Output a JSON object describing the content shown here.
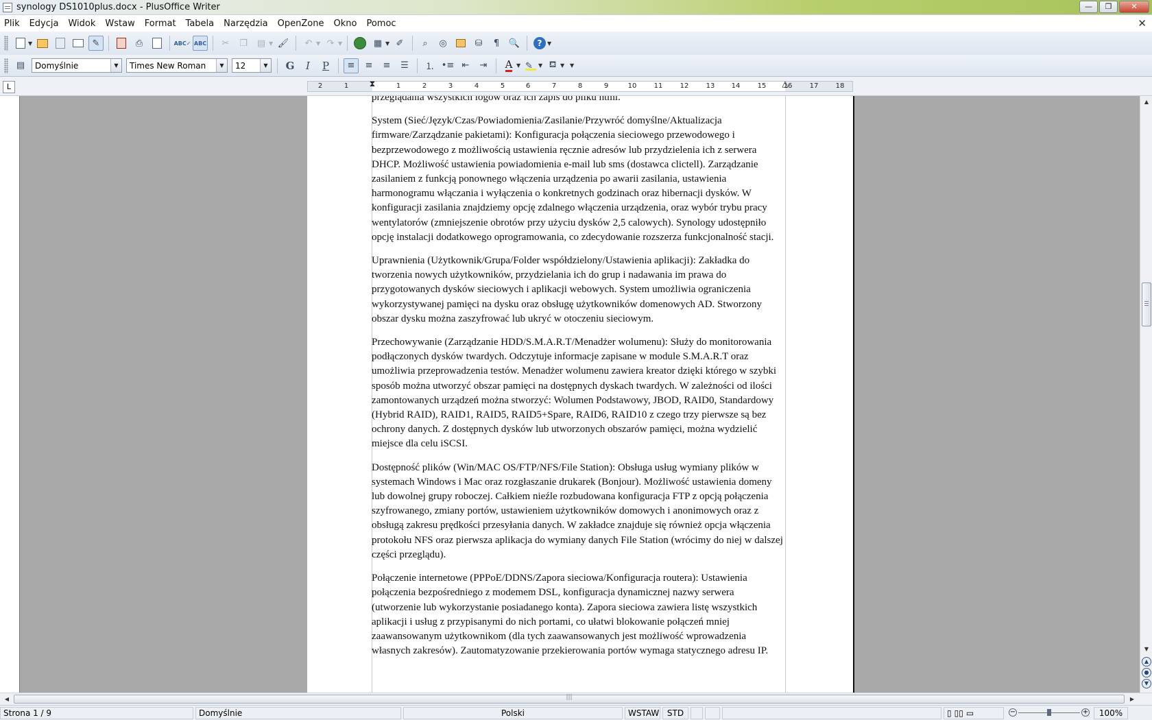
{
  "window": {
    "title": "synology DS1010plus.docx - PlusOffice Writer",
    "minimize": "—",
    "maximize": "❐",
    "close": "✕"
  },
  "menu": {
    "items": [
      "Plik",
      "Edycja",
      "Widok",
      "Wstaw",
      "Format",
      "Tabela",
      "Narzędzia",
      "OpenZone",
      "Okno",
      "Pomoc"
    ],
    "close_doc": "✕"
  },
  "format_toolbar": {
    "style": "Domyślnie",
    "font": "Times New Roman",
    "size": "12",
    "bold": "G",
    "italic": "I",
    "underline": "P",
    "font_color": "A"
  },
  "ruler": {
    "tab_type": "L",
    "labels": [
      "2",
      "1",
      "1",
      "2",
      "3",
      "4",
      "5",
      "6",
      "7",
      "8",
      "9",
      "10",
      "11",
      "12",
      "13",
      "14",
      "15",
      "16",
      "17",
      "18"
    ]
  },
  "document": {
    "paragraphs": [
      "przeglądania wszystkich logów oraz ich zapis do pliku html.",
      "System (Sieć/Język/Czas/Powiadomienia/Zasilanie/Przywróć domyślne/Aktualizacja firmware/Zarządzanie pakietami): Konfiguracja połączenia sieciowego przewodowego i bezprzewodowego z możliwością ustawienia ręcznie adresów lub przydzielenia ich z serwera DHCP. Możliwość ustawienia powiadomienia e-mail lub sms (dostawca clictell). Zarządzanie zasilaniem z funkcją ponownego włączenia urządzenia po awarii zasilania, ustawienia harmonogramu włączania i wyłączenia o konkretnych godzinach oraz hibernacji dysków. W konfiguracji zasilania znajdziemy opcję zdalnego włączenia urządzenia, oraz wybór trybu pracy wentylatorów (zmniejszenie obrotów przy użyciu dysków 2,5 calowych). Synology udostępniło opcję instalacji dodatkowego oprogramowania, co zdecydowanie rozszerza funkcjonalność stacji.",
      "Uprawnienia (Użytkownik/Grupa/Folder współdzielony/Ustawienia aplikacji): Zakładka do tworzenia nowych użytkowników, przydzielania ich do grup i nadawania im prawa do przygotowanych dysków sieciowych i aplikacji webowych. System umożliwia ograniczenia wykorzystywanej pamięci na dysku oraz obsługę użytkowników domenowych AD. Stworzony obszar dysku można zaszyfrować lub ukryć w otoczeniu sieciowym.",
      "Przechowywanie (Zarządzanie HDD/S.M.A.R.T/Menadżer wolumenu): Służy do monitorowania podłączonych dysków twardych. Odczytuje informacje zapisane w module S.M.A.R.T oraz umożliwia przeprowadzenia testów. Menadżer wolumenu zawiera kreator dzięki którego w szybki sposób można utworzyć obszar pamięci na dostępnych dyskach twardych. W zależności od ilości zamontowanych urządzeń można stworzyć: Wolumen Podstawowy, JBOD, RAID0, Standardowy (Hybrid RAID), RAID1, RAID5, RAID5+Spare, RAID6, RAID10 z czego trzy pierwsze są bez ochrony danych. Z dostępnych dysków lub utworzonych obszarów pamięci, można wydzielić miejsce dla celu iSCSI.",
      "Dostępność plików (Win/MAC OS/FTP/NFS/File Station): Obsługa usług wymiany plików w systemach Windows i Mac oraz rozgłaszanie drukarek (Bonjour). Możliwość ustawienia domeny lub dowolnej grupy roboczej. Całkiem nieźle rozbudowana konfiguracja FTP z opcją połączenia szyfrowanego, zmiany portów,  ustawieniem użytkowników domowych i anonimowych oraz z obsługą zakresu prędkości przesyłania danych. W zakładce znajduje się również opcja włączenia protokołu NFS oraz pierwsza aplikacja do wymiany danych File Station (wrócimy do niej w dalszej części przeglądu).",
      "Połączenie internetowe (PPPoE/DDNS/Zapora sieciowa/Konfiguracja routera): Ustawienia połączenia bezpośredniego z modemem DSL, konfiguracja dynamicznej nazwy serwera (utworzenie lub wykorzystanie posiadanego konta). Zapora sieciowa zawiera listę wszystkich aplikacji i usług z przypisanymi do nich portami, co ułatwi blokowanie połączeń mniej zaawansowanym użytkownikom (dla tych zaawansowanych jest możliwość wprowadzenia własnych zakresów). Zautomatyzowanie przekierowania portów wymaga statycznego adresu IP."
    ]
  },
  "statusbar": {
    "page": "Strona  1 / 9",
    "style": "Domyślnie",
    "language": "Polski",
    "insert_mode": "WSTAW",
    "selection_mode": "STD",
    "zoom": "100%",
    "zoom_level_percent": 100
  },
  "icons": {
    "standard_toolbar": [
      "new-document-icon",
      "open-folder-icon",
      "save-icon",
      "edit-mode-icon",
      "export-pdf-icon",
      "print-icon",
      "print-preview-icon",
      "spellcheck-icon",
      "auto-spellcheck-icon",
      "cut-icon",
      "copy-icon",
      "paste-icon",
      "clone-format-icon",
      "undo-icon",
      "redo-icon",
      "hyperlink-icon",
      "table-icon",
      "draw-icon",
      "find-replace-icon",
      "navigator-icon",
      "gallery-icon",
      "data-sources-icon",
      "formatting-marks-icon",
      "zoom-icon",
      "help-icon"
    ],
    "accent": "#2f6fc0"
  }
}
